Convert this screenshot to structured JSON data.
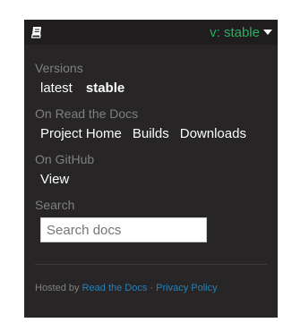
{
  "header": {
    "icon": "book-icon",
    "version_label": "v: stable",
    "caret_icon": "caret-down-icon",
    "accent_color": "#27ae60"
  },
  "versions": {
    "title": "Versions",
    "items": [
      {
        "label": "latest",
        "current": false
      },
      {
        "label": "stable",
        "current": true
      }
    ]
  },
  "read_the_docs": {
    "title": "On Read the Docs",
    "items": [
      {
        "label": "Project Home"
      },
      {
        "label": "Builds"
      },
      {
        "label": "Downloads"
      }
    ]
  },
  "github": {
    "title": "On GitHub",
    "items": [
      {
        "label": "View"
      }
    ]
  },
  "search": {
    "title": "Search",
    "placeholder": "Search docs"
  },
  "footer": {
    "prefix": "Hosted by ",
    "rtd_link": "Read the Docs",
    "separator": " · ",
    "privacy_link": "Privacy Policy",
    "link_color": "#2980b9"
  }
}
